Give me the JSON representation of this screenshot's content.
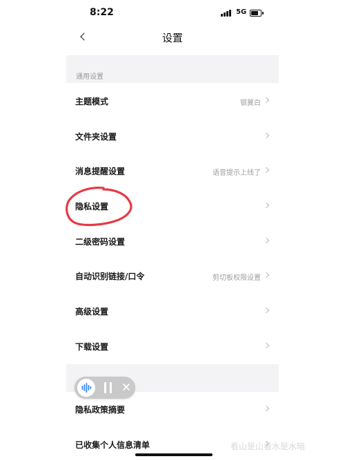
{
  "status_bar": {
    "time": "8:22",
    "network": "5G"
  },
  "nav": {
    "title": "设置"
  },
  "sections": [
    {
      "header": "通用设置",
      "rows": [
        {
          "title": "主题模式",
          "value": "银翼白"
        },
        {
          "title": "文件夹设置",
          "value": ""
        },
        {
          "title": "消息提醒设置",
          "value": "语音提示上线了"
        },
        {
          "title": "隐私设置",
          "value": ""
        },
        {
          "title": "二级密码设置",
          "value": ""
        },
        {
          "title": "自动识别链接/口令",
          "value": "剪切板权限设置"
        },
        {
          "title": "高级设置",
          "value": ""
        },
        {
          "title": "下载设置",
          "value": ""
        }
      ]
    },
    {
      "header": "",
      "rows": [
        {
          "title": "隐私政策摘要",
          "value": ""
        },
        {
          "title": "已收集个人信息清单",
          "value": ""
        }
      ]
    }
  ],
  "watermark": {
    "text": "看山是山看水是水暗"
  },
  "colors": {
    "annotation": "#e53b46",
    "section_bg": "#f3f3f5",
    "voice_wave": "#3a88ff"
  },
  "icons": {
    "back": "chevron-left-icon",
    "row_arrow": "chevron-right-icon",
    "voice": "sound-wave-icon",
    "pause": "pause-icon",
    "close": "close-icon"
  }
}
